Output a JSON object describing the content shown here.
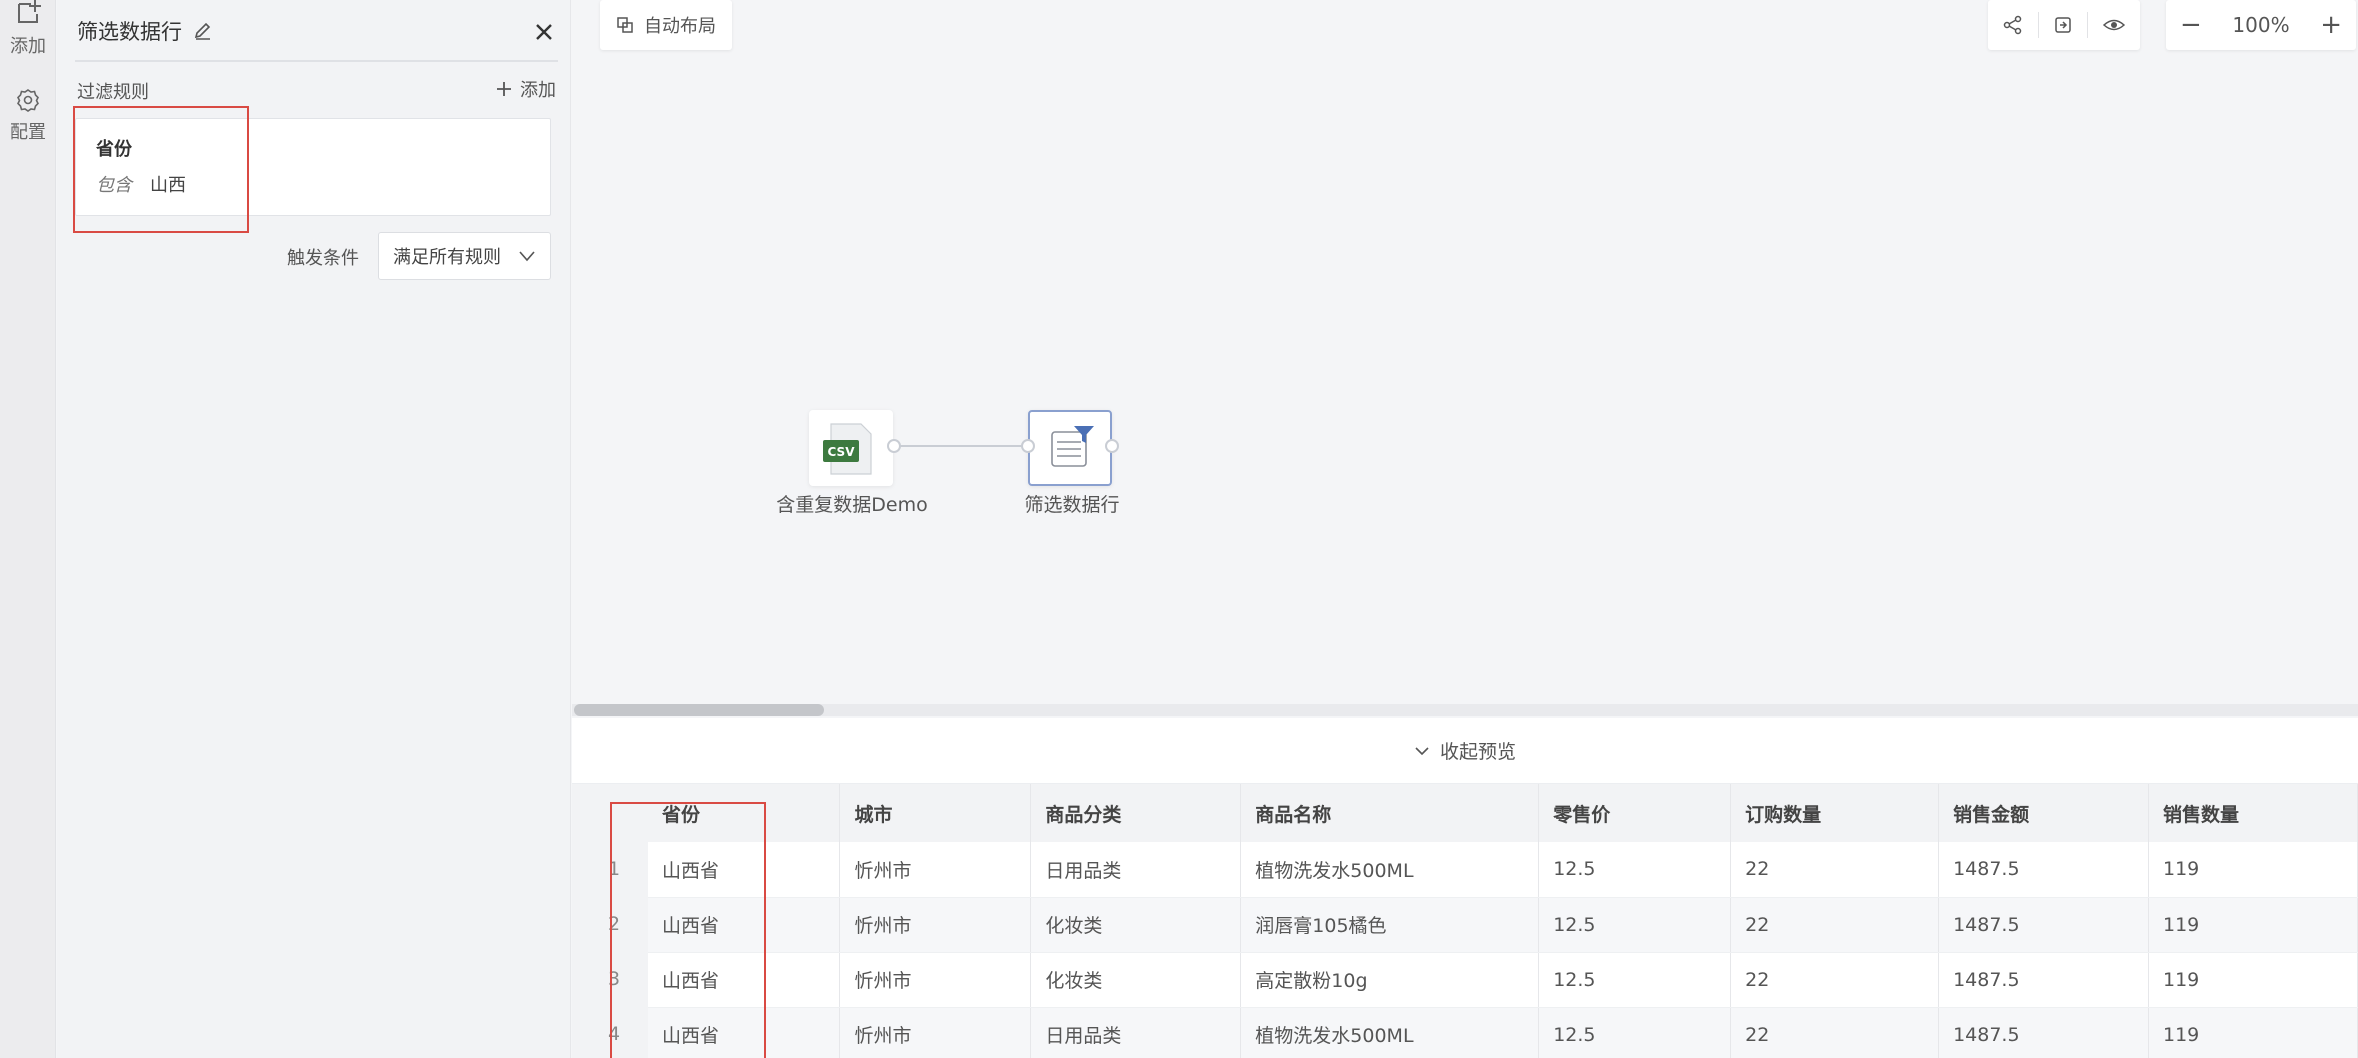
{
  "rail": {
    "add_label": "添加",
    "config_label": "配置"
  },
  "panel": {
    "title": "筛选数据行",
    "rules_label": "过滤规则",
    "add_label": "添加",
    "rule": {
      "field": "省份",
      "operator": "包含",
      "value": "山西"
    },
    "trigger_label": "触发条件",
    "trigger_value": "满足所有规则"
  },
  "canvas": {
    "auto_layout_label": "自动布局",
    "zoom_level": "100%",
    "nodes": [
      {
        "label": "含重复数据Demo",
        "icon": "csv-file-icon",
        "icon_text": "CSV"
      },
      {
        "label": "筛选数据行",
        "icon": "filter-rows-icon"
      }
    ]
  },
  "preview": {
    "collapse_label": "收起预览",
    "columns": [
      "省份",
      "城市",
      "商品分类",
      "商品名称",
      "零售价",
      "订购数量",
      "销售金额",
      "销售数量"
    ],
    "rows": [
      {
        "num": "1",
        "cells": [
          "山西省",
          "忻州市",
          "日用品类",
          "植物洗发水500ML",
          "12.5",
          "22",
          "1487.5",
          "119"
        ]
      },
      {
        "num": "2",
        "cells": [
          "山西省",
          "忻州市",
          "化妆类",
          "润唇膏105橘色",
          "12.5",
          "22",
          "1487.5",
          "119"
        ]
      },
      {
        "num": "3",
        "cells": [
          "山西省",
          "忻州市",
          "化妆类",
          "高定散粉10g",
          "12.5",
          "22",
          "1487.5",
          "119"
        ]
      },
      {
        "num": "4",
        "cells": [
          "山西省",
          "忻州市",
          "日用品类",
          "植物洗发水500ML",
          "12.5",
          "22",
          "1487.5",
          "119"
        ]
      }
    ]
  },
  "colors": {
    "highlight": "#d94a43",
    "csv_green": "#3d7a3f",
    "node_selected_border": "#8aa0cf"
  }
}
